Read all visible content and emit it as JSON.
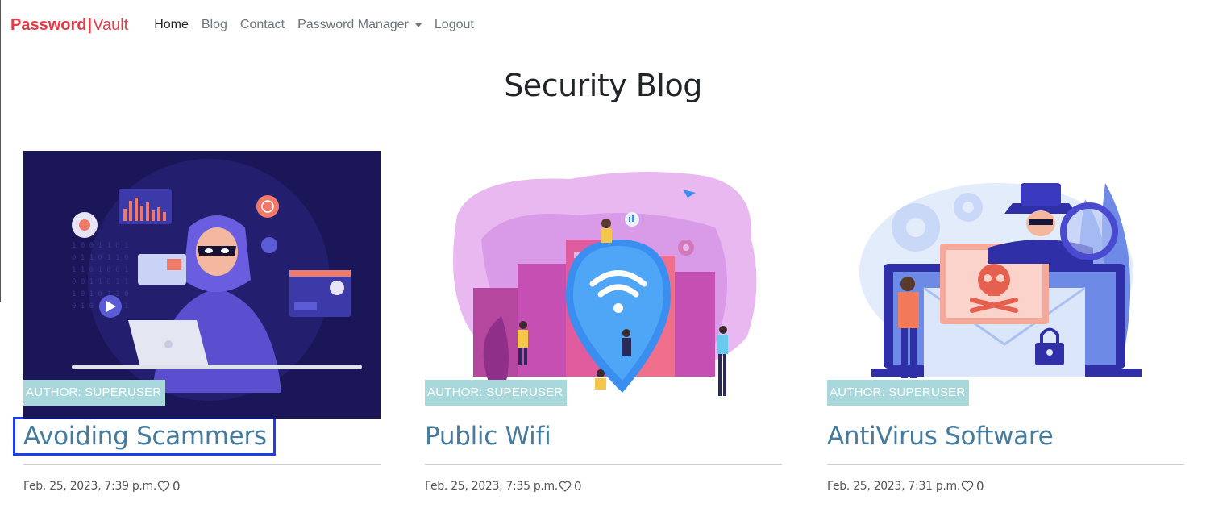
{
  "nav": {
    "brand_part1": "Password",
    "brand_sep": "|",
    "brand_part2": "Vault",
    "links": [
      {
        "label": "Home"
      },
      {
        "label": "Blog"
      },
      {
        "label": "Contact"
      },
      {
        "label": "Password Manager"
      },
      {
        "label": "Logout"
      }
    ]
  },
  "page": {
    "title": "Security Blog"
  },
  "posts": [
    {
      "author": "AUTHOR: SUPERUSER",
      "title": "Avoiding Scammers",
      "date": "Feb. 25, 2023, 7:39 p.m.",
      "likes": "0",
      "image": "hacker-illustration"
    },
    {
      "author": "AUTHOR: SUPERUSER",
      "title": "Public Wifi",
      "date": "Feb. 25, 2023, 7:35 p.m.",
      "likes": "0",
      "image": "public-wifi-illustration"
    },
    {
      "author": "AUTHOR: SUPERUSER",
      "title": "AntiVirus Software",
      "date": "Feb. 25, 2023, 7:31 p.m.",
      "likes": "0",
      "image": "antivirus-illustration"
    }
  ],
  "colors": {
    "brand": "#e63946",
    "post_title": "#457b9d",
    "badge": "#a8d8db",
    "selection": "#1d3ee8"
  }
}
